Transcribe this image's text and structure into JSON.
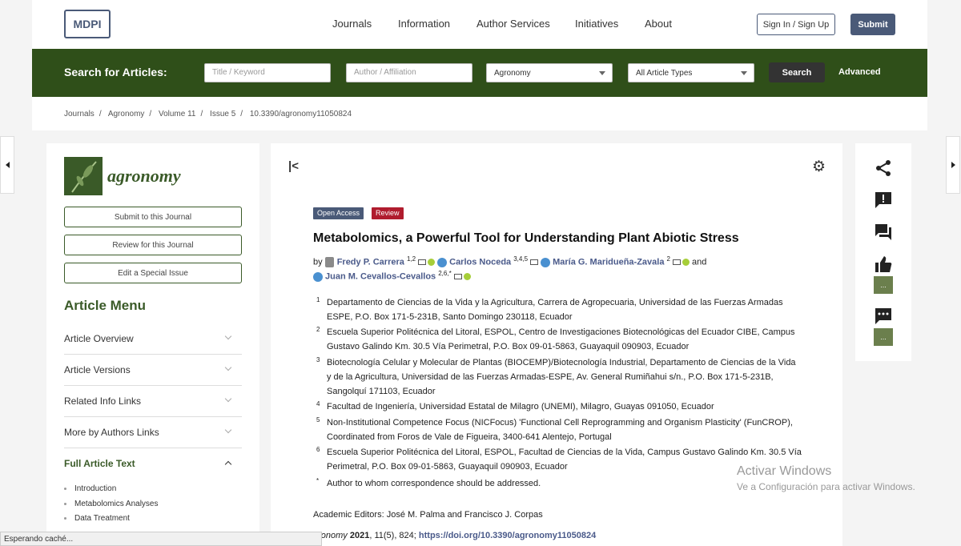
{
  "header": {
    "logo": "MDPI",
    "nav": [
      "Journals",
      "Information",
      "Author Services",
      "Initiatives",
      "About"
    ],
    "sign_in": "Sign In / Sign Up",
    "submit": "Submit"
  },
  "search": {
    "label": "Search for Articles:",
    "title_placeholder": "Title / Keyword",
    "author_placeholder": "Author / Affiliation",
    "journal_select": "Agronomy",
    "type_select": "All Article Types",
    "button": "Search",
    "advanced": "Advanced"
  },
  "breadcrumb": [
    "Journals",
    "Agronomy",
    "Volume 11",
    "Issue 5",
    "10.3390/agronomy11050824"
  ],
  "sidebar": {
    "journal_name": "agronomy",
    "buttons": [
      "Submit to this Journal",
      "Review for this Journal",
      "Edit a Special Issue"
    ],
    "menu_title": "Article Menu",
    "menu_items": [
      "Article Overview",
      "Article Versions",
      "Related Info Links",
      "More by Authors Links"
    ],
    "full_text_title": "Full Article Text",
    "sub_items": [
      "Introduction",
      "Metabolomics Analyses",
      "Data Treatment"
    ]
  },
  "article": {
    "badges": [
      "Open Access",
      "Review"
    ],
    "title": "Metabolomics, a Powerful Tool for Understanding Plant Abiotic Stress",
    "by": "by",
    "and": "and",
    "authors": [
      {
        "name": "Fredy P. Carrera",
        "sup": "1,2"
      },
      {
        "name": "Carlos Noceda",
        "sup": "3,4,5"
      },
      {
        "name": "María G. Maridueña-Zavala",
        "sup": "2"
      },
      {
        "name": "Juan M. Cevallos-Cevallos",
        "sup": "2,6,*"
      }
    ],
    "affiliations": [
      {
        "num": "1",
        "text": "Departamento de Ciencias de la Vida y la Agricultura, Carrera de Agropecuaria, Universidad de las Fuerzas Armadas ESPE, P.O. Box 171-5-231B, Santo Domingo 230118, Ecuador"
      },
      {
        "num": "2",
        "text": "Escuela Superior Politécnica del Litoral, ESPOL, Centro de Investigaciones Biotecnológicas del Ecuador CIBE, Campus Gustavo Galindo Km. 30.5 Vía Perimetral, P.O. Box 09-01-5863, Guayaquil 090903, Ecuador"
      },
      {
        "num": "3",
        "text": "Biotecnología Celular y Molecular de Plantas (BIOCEMP)/Biotecnología Industrial, Departamento de Ciencias de la Vida y de la Agricultura, Universidad de las Fuerzas Armadas-ESPE, Av. General Rumiñahui s/n., P.O. Box 171-5-231B, Sangolquí 171103, Ecuador"
      },
      {
        "num": "4",
        "text": "Facultad de Ingeniería, Universidad Estatal de Milagro (UNEMI), Milagro, Guayas 091050, Ecuador"
      },
      {
        "num": "5",
        "text": "Non-Institutional Competence Focus (NICFocus) 'Functional Cell Reprogramming and Organism Plasticity' (FunCROP), Coordinated from Foros de Vale de Figueira, 3400-641 Alentejo, Portugal"
      },
      {
        "num": "6",
        "text": "Escuela Superior Politécnica del Litoral, ESPOL, Facultad de Ciencias de la Vida, Campus Gustavo Galindo Km. 30.5 Vía Perimetral, P.O. Box 09-01-5863, Guayaquil 090903, Ecuador"
      },
      {
        "num": "*",
        "text": "Author to whom correspondence should be addressed."
      }
    ],
    "editors": "Academic Editors: José M. Palma and Francisco J. Corpas",
    "citation_journal": "gronomy",
    "citation_year": "2021",
    "citation_rest": ", 11(5), 824;",
    "doi": "https://doi.org/10.3390/agronomy11050824"
  },
  "watermark": {
    "line1": "Activar Windows",
    "line2": "Ve a Configuración para activar Windows."
  },
  "status_text": "Esperando caché..."
}
